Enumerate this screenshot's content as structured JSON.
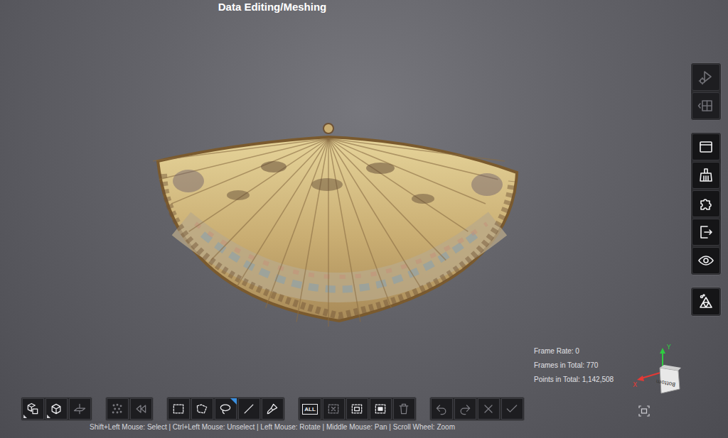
{
  "window": {
    "title": "Data Editing/Meshing"
  },
  "right_toolbar": [
    {
      "buttons": [
        {
          "disabled": true
        },
        {
          "disabled": true
        }
      ]
    },
    {
      "buttons": [
        {
          "disabled": false
        },
        {
          "disabled": false
        },
        {
          "disabled": false
        },
        {
          "disabled": false
        },
        {
          "disabled": false
        }
      ]
    },
    {
      "buttons": [
        {
          "disabled": false
        }
      ]
    }
  ],
  "bottom_toolbar": [
    {
      "buttons": [
        {
          "disabled": false,
          "has_menu": true,
          "selected": false
        },
        {
          "disabled": false,
          "has_menu": true,
          "selected": false
        },
        {
          "disabled": true,
          "has_menu": false,
          "selected": false
        }
      ]
    },
    {
      "buttons": [
        {
          "disabled": true,
          "has_menu": false,
          "selected": false
        },
        {
          "disabled": true,
          "has_menu": false,
          "selected": false
        }
      ]
    },
    {
      "buttons": [
        {
          "disabled": false,
          "has_menu": false,
          "selected": false
        },
        {
          "disabled": false,
          "has_menu": false,
          "selected": false
        },
        {
          "disabled": false,
          "has_menu": false,
          "selected": true
        },
        {
          "disabled": false,
          "has_menu": false,
          "selected": false
        },
        {
          "disabled": false,
          "has_menu": false,
          "selected": false
        }
      ]
    },
    {
      "buttons": [
        {
          "label": "ALL",
          "disabled": false,
          "has_menu": false,
          "selected": false
        },
        {
          "disabled": true,
          "has_menu": false,
          "selected": false
        },
        {
          "disabled": false,
          "has_menu": false,
          "selected": false
        },
        {
          "disabled": false,
          "has_menu": false,
          "selected": false
        },
        {
          "disabled": true,
          "has_menu": false,
          "selected": false
        }
      ]
    },
    {
      "buttons": [
        {
          "disabled": true,
          "has_menu": false,
          "selected": false
        },
        {
          "disabled": true,
          "has_menu": false,
          "selected": false
        },
        {
          "disabled": true,
          "has_menu": false,
          "selected": false
        },
        {
          "disabled": true,
          "has_menu": false,
          "selected": false
        }
      ]
    }
  ],
  "stats": [
    "Frame Rate: 0",
    "Frames in Total: 770",
    "Points in Total: 1,142,508"
  ],
  "gizmo": {
    "y": "Y",
    "x": "X",
    "face": "Bottom"
  },
  "hint": "Shift+Left Mouse: Select | Ctrl+Left Mouse: Unselect | Left Mouse: Rotate | Middle Mouse: Pan | Scroll Wheel: Zoom"
}
